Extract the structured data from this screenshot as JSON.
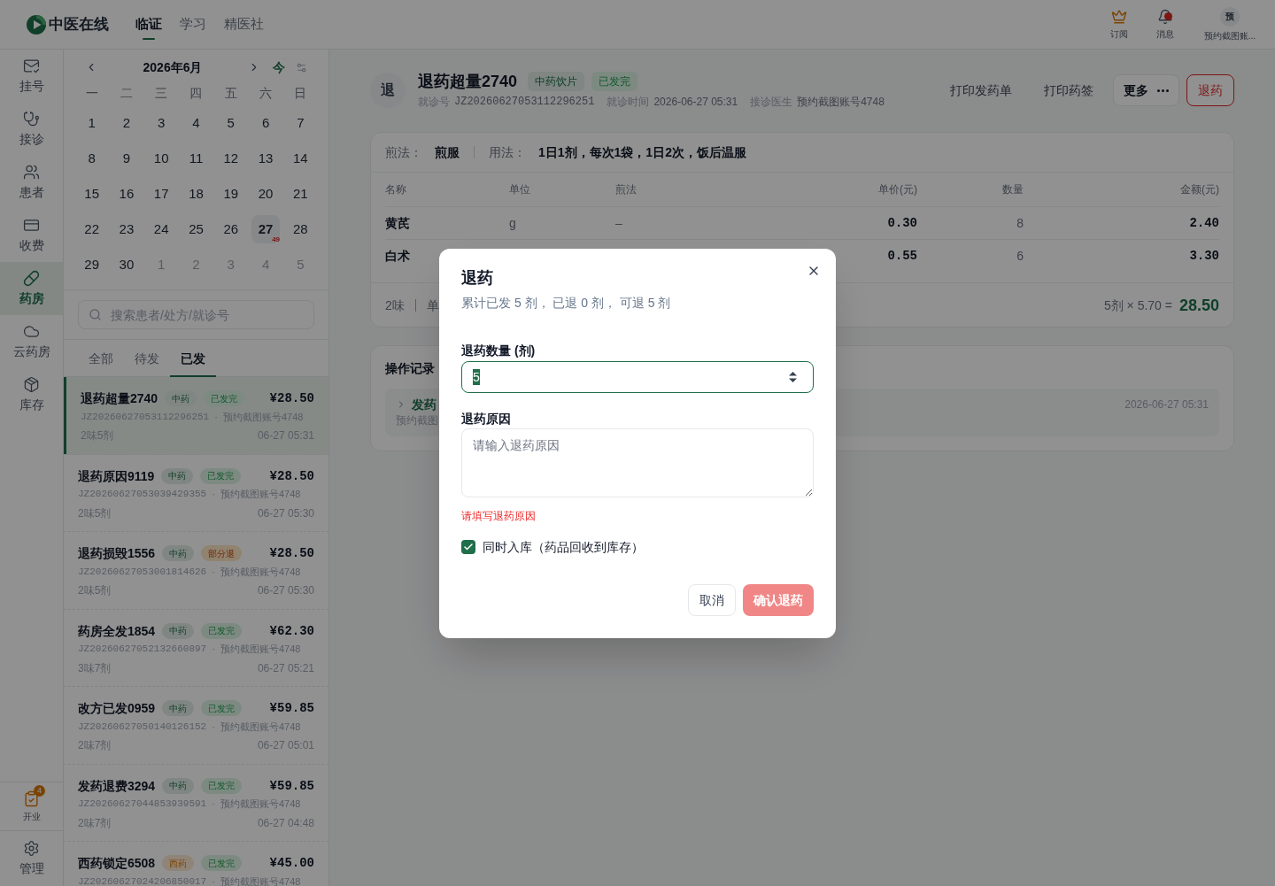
{
  "top_bar": {
    "logo": "中医在线",
    "nav": [
      {
        "label": "临证",
        "selected": true
      },
      {
        "label": "学习",
        "selected": false
      },
      {
        "label": "精医社",
        "selected": false
      }
    ],
    "actions": [
      {
        "label": "订阅",
        "unread": false
      },
      {
        "label": "消息",
        "unread": true
      }
    ],
    "user": {
      "avatar": "预",
      "name": "预约截图账..."
    }
  },
  "sidebar": {
    "items": [
      {
        "label": "挂号",
        "selected": false
      },
      {
        "label": "接诊",
        "selected": false
      },
      {
        "label": "患者",
        "selected": false
      },
      {
        "label": "收费",
        "selected": false
      },
      {
        "label": "药房",
        "selected": true
      },
      {
        "label": "云药房",
        "selected": false
      },
      {
        "label": "库存",
        "selected": false
      }
    ],
    "bottom_items": [
      {
        "label": "开业",
        "badge": "4"
      },
      {
        "label": "管理"
      }
    ]
  },
  "calendar": {
    "title": "2026年6月",
    "today_label": "今",
    "weekdays": [
      "一",
      "二",
      "三",
      "四",
      "五",
      "六",
      "日"
    ],
    "days": [
      {
        "text": "1",
        "muted": false,
        "selected": false
      },
      {
        "text": "2",
        "muted": false,
        "selected": false
      },
      {
        "text": "3",
        "muted": false,
        "selected": false
      },
      {
        "text": "4",
        "muted": false,
        "selected": false
      },
      {
        "text": "5",
        "muted": false,
        "selected": false
      },
      {
        "text": "6",
        "muted": false,
        "selected": false
      },
      {
        "text": "7",
        "muted": false,
        "selected": false
      },
      {
        "text": "8",
        "muted": false,
        "selected": false
      },
      {
        "text": "9",
        "muted": false,
        "selected": false
      },
      {
        "text": "10",
        "muted": false,
        "selected": false
      },
      {
        "text": "11",
        "muted": false,
        "selected": false
      },
      {
        "text": "12",
        "muted": false,
        "selected": false
      },
      {
        "text": "13",
        "muted": false,
        "selected": false
      },
      {
        "text": "14",
        "muted": false,
        "selected": false
      },
      {
        "text": "15",
        "muted": false,
        "selected": false
      },
      {
        "text": "16",
        "muted": false,
        "selected": false
      },
      {
        "text": "17",
        "muted": false,
        "selected": false
      },
      {
        "text": "18",
        "muted": false,
        "selected": false
      },
      {
        "text": "19",
        "muted": false,
        "selected": false
      },
      {
        "text": "20",
        "muted": false,
        "selected": false
      },
      {
        "text": "21",
        "muted": false,
        "selected": false
      },
      {
        "text": "22",
        "muted": false,
        "selected": false
      },
      {
        "text": "23",
        "muted": false,
        "selected": false
      },
      {
        "text": "24",
        "muted": false,
        "selected": false
      },
      {
        "text": "25",
        "muted": false,
        "selected": false
      },
      {
        "text": "26",
        "muted": false,
        "selected": false
      },
      {
        "text": "27",
        "muted": false,
        "selected": true,
        "count": "49"
      },
      {
        "text": "28",
        "muted": false,
        "selected": false
      },
      {
        "text": "29",
        "muted": false,
        "selected": false
      },
      {
        "text": "30",
        "muted": false,
        "selected": false
      },
      {
        "text": "1",
        "muted": true,
        "selected": false
      },
      {
        "text": "2",
        "muted": true,
        "selected": false
      },
      {
        "text": "3",
        "muted": true,
        "selected": false
      },
      {
        "text": "4",
        "muted": true,
        "selected": false
      },
      {
        "text": "5",
        "muted": true,
        "selected": false
      }
    ]
  },
  "search": {
    "placeholder": "搜索患者/处方/就诊号"
  },
  "filter_tabs": [
    {
      "label": "全部",
      "selected": false
    },
    {
      "label": "待发",
      "selected": false
    },
    {
      "label": "已发",
      "selected": true
    }
  ],
  "orders": [
    {
      "name": "退药超量2740",
      "tags": [
        {
          "label": "中药",
          "kind": "herbal"
        },
        {
          "label": "已发完",
          "kind": "complete"
        }
      ],
      "price": "¥28.50",
      "number": "JZ20260627053112296251",
      "separator": "·",
      "doctor": "预约截图账号4748",
      "summary": "2味5剂",
      "time": "06-27 05:31",
      "selected": true
    },
    {
      "name": "退药原因9119",
      "tags": [
        {
          "label": "中药",
          "kind": "herbal"
        },
        {
          "label": "已发完",
          "kind": "complete"
        }
      ],
      "price": "¥28.50",
      "number": "JZ20260627053039429355",
      "separator": "·",
      "doctor": "预约截图账号4748",
      "summary": "2味5剂",
      "time": "06-27 05:30",
      "selected": false
    },
    {
      "name": "退药损毁1556",
      "tags": [
        {
          "label": "中药",
          "kind": "herbal"
        },
        {
          "label": "部分退",
          "kind": "partial"
        }
      ],
      "price": "¥28.50",
      "number": "JZ20260627053001814626",
      "separator": "·",
      "doctor": "预约截图账号4748",
      "summary": "2味5剂",
      "time": "06-27 05:30",
      "selected": false
    },
    {
      "name": "药房全发1854",
      "tags": [
        {
          "label": "中药",
          "kind": "herbal"
        },
        {
          "label": "已发完",
          "kind": "complete"
        }
      ],
      "price": "¥62.30",
      "number": "JZ20260627052132660897",
      "separator": "·",
      "doctor": "预约截图账号4748",
      "summary": "3味7剂",
      "time": "06-27 05:21",
      "selected": false
    },
    {
      "name": "改方已发0959",
      "tags": [
        {
          "label": "中药",
          "kind": "herbal"
        },
        {
          "label": "已发完",
          "kind": "complete"
        }
      ],
      "price": "¥59.85",
      "number": "JZ20260627050140126152",
      "separator": "·",
      "doctor": "预约截图账号4748",
      "summary": "2味7剂",
      "time": "06-27 05:01",
      "selected": false
    },
    {
      "name": "发药退费3294",
      "tags": [
        {
          "label": "中药",
          "kind": "herbal"
        },
        {
          "label": "已发完",
          "kind": "complete"
        }
      ],
      "price": "¥59.85",
      "number": "JZ20260627044853939591",
      "separator": "·",
      "doctor": "预约截图账号4748",
      "summary": "2味7剂",
      "time": "06-27 04:48",
      "selected": false
    },
    {
      "name": "西药锁定6508",
      "tags": [
        {
          "label": "西药",
          "kind": "western"
        },
        {
          "label": "已发完",
          "kind": "complete"
        }
      ],
      "price": "¥45.00",
      "number": "JZ20260627024206850017",
      "separator": "·",
      "doctor": "预约截图账号4748",
      "selected": false
    }
  ],
  "detail": {
    "avatar": "退",
    "title": "退药超量2740",
    "tags": [
      {
        "label": "中药饮片",
        "kind": "herbal"
      },
      {
        "label": "已发完",
        "kind": "complete"
      }
    ],
    "meta": [
      {
        "label": "就诊号",
        "value": "JZ20260627053112296251"
      },
      {
        "label": "就诊时间",
        "value": "2026-06-27 05:31"
      },
      {
        "label": "接诊医生",
        "value": "预约截图账号4748"
      }
    ],
    "actions": [
      {
        "kind": "text",
        "label": "打印发药单"
      },
      {
        "kind": "text",
        "label": "打印药签"
      },
      {
        "kind": "more",
        "label": "更多"
      },
      {
        "kind": "danger",
        "label": "退药"
      }
    ],
    "usage": [
      {
        "label": "煎法：",
        "value": "煎服"
      },
      {
        "label": "用法：",
        "value": "1日1剂，每次1袋，1日2次，饭后温服"
      }
    ],
    "table": {
      "columns": [
        "名称",
        "单位",
        "煎法",
        "单价(元)",
        "数量",
        "金额(元)"
      ],
      "rows": [
        {
          "name": "黄芪",
          "unit": "g",
          "method": "–",
          "price": "0.30",
          "qty": "8",
          "amount": "2.40"
        },
        {
          "name": "白术",
          "price": "0.55",
          "qty": "6",
          "amount": "3.30"
        }
      ]
    },
    "footer": {
      "summary": [
        "2味",
        "单"
      ],
      "formula": "5剂 × 5.70 =",
      "total": "28.50"
    },
    "log": {
      "title": "操作记录",
      "entries": [
        {
          "action": "发药",
          "actor": "预约截图",
          "time": "2026-06-27 05:31",
          "expanded": false
        }
      ]
    }
  },
  "modal": {
    "title": "退药",
    "subtitle": "累计已发 5 剂， 已退 0 剂， 可退 5 剂",
    "fields": [
      {
        "kind": "number",
        "label": "退药数量 (剂)",
        "value": "5",
        "focused": true
      },
      {
        "kind": "textarea",
        "label": "退药原因",
        "placeholder": "请输入退药原因",
        "error": "请填写退药原因"
      }
    ],
    "restock": {
      "label": "同时入库（药品回收到库存）",
      "checked": true
    },
    "buttons": [
      {
        "kind": "secondary",
        "label": "取消",
        "disabled": false
      },
      {
        "kind": "primary",
        "label": "确认退药",
        "disabled": true
      }
    ]
  }
}
